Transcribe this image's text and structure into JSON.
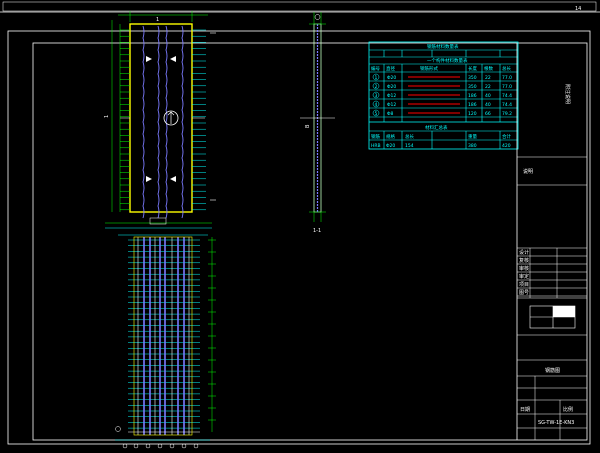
{
  "app": "CAD drawing viewer",
  "title_block": {
    "rows_left": [
      "设计",
      "复核",
      "审核",
      "审定",
      "项目",
      "图号"
    ],
    "drawing_label": "钢筋图",
    "bottom_left": "日期",
    "bottom_mid": "比例",
    "sheet_code": "SG-TW-1E-KN3"
  },
  "side_note": "说明",
  "side_vertical_text": "附注说明",
  "table": {
    "title": "钢筋材料数量表",
    "subtitle": "一个构件材料数量表",
    "headers": [
      "编号",
      "直径",
      "钢筋形式",
      "长度",
      "根数",
      "总长"
    ],
    "rows": [
      {
        "id": "1",
        "d": "Φ20",
        "len": "350",
        "n": "22",
        "tot": "77.0"
      },
      {
        "id": "2",
        "d": "Φ20",
        "len": "350",
        "n": "22",
        "tot": "77.0"
      },
      {
        "id": "3",
        "d": "Φ12",
        "len": "186",
        "n": "40",
        "tot": "74.4"
      },
      {
        "id": "4",
        "d": "Φ12",
        "len": "186",
        "n": "40",
        "tot": "74.4"
      },
      {
        "id": "5",
        "d": "Φ8",
        "len": "120",
        "n": "66",
        "tot": "79.2"
      }
    ],
    "summary_title": "材料汇总表",
    "summary_headers": [
      "钢筋",
      "规格",
      "总长",
      "重量",
      "合计"
    ],
    "summary_row": [
      "HRB",
      "Φ20",
      "154",
      "380",
      "420"
    ]
  },
  "colors": {
    "background": "#000000",
    "frame": "#ffffff",
    "rebar_yellow": "#ffff00",
    "dimension_green": "#00ff00",
    "table_cyan": "#00ffff",
    "rebar_blue": "#7b7bff",
    "rebar_red": "#ff0000"
  }
}
